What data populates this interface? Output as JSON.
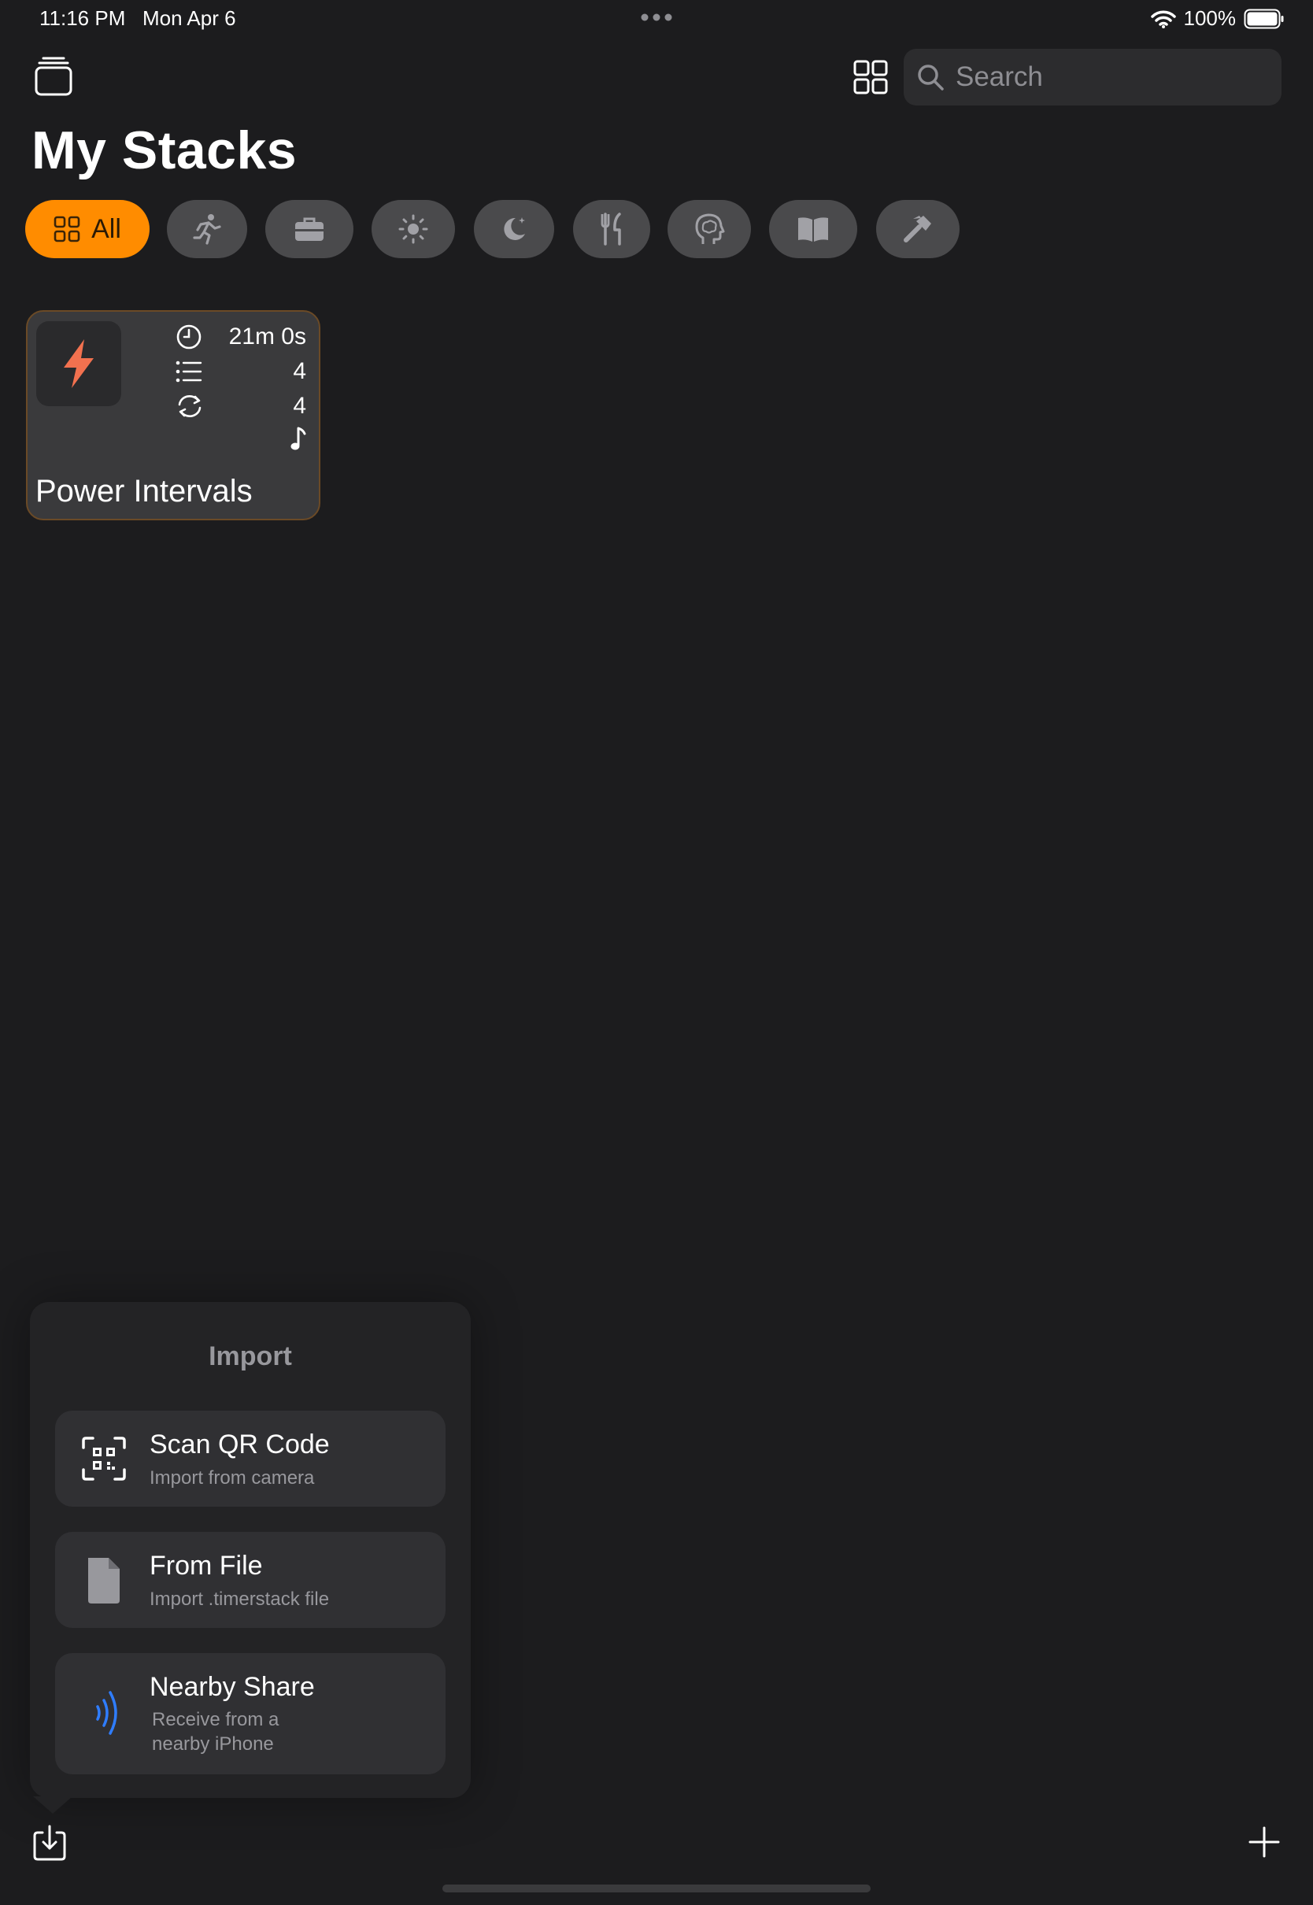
{
  "status_bar": {
    "time_date": "11:16 PM   Mon Apr 6",
    "battery": "100%"
  },
  "toolbar": {
    "search_placeholder": "Search"
  },
  "page": {
    "title": "My Stacks"
  },
  "filters": {
    "all_label": "All",
    "chips": [
      {
        "icon": "all-grid-icon",
        "selected": true
      },
      {
        "icon": "running-icon"
      },
      {
        "icon": "briefcase-icon"
      },
      {
        "icon": "sun-icon"
      },
      {
        "icon": "moon-icon"
      },
      {
        "icon": "fork-knife-icon"
      },
      {
        "icon": "head-brain-icon"
      },
      {
        "icon": "book-icon"
      },
      {
        "icon": "hammer-icon"
      }
    ]
  },
  "stacks": [
    {
      "title": "Power Intervals",
      "icon": "bolt-icon",
      "duration": "21m 0s",
      "steps": "4",
      "rounds": "4",
      "has_music": true
    }
  ],
  "import_popover": {
    "title": "Import",
    "options": [
      {
        "title": "Scan QR Code",
        "subtitle": "Import from camera",
        "icon": "qr-scan-icon"
      },
      {
        "title": "From File",
        "subtitle": "Import .timerstack file",
        "icon": "file-icon"
      },
      {
        "title": "Nearby Share",
        "subtitle_line1": "Receive from a",
        "subtitle_line2": "nearby iPhone",
        "icon": "nearby-share-icon"
      }
    ]
  },
  "colors": {
    "accent": "#ff8c00",
    "background": "#1c1c1e",
    "bolt": "#f2714f",
    "nearby_blue": "#2f7dff"
  }
}
